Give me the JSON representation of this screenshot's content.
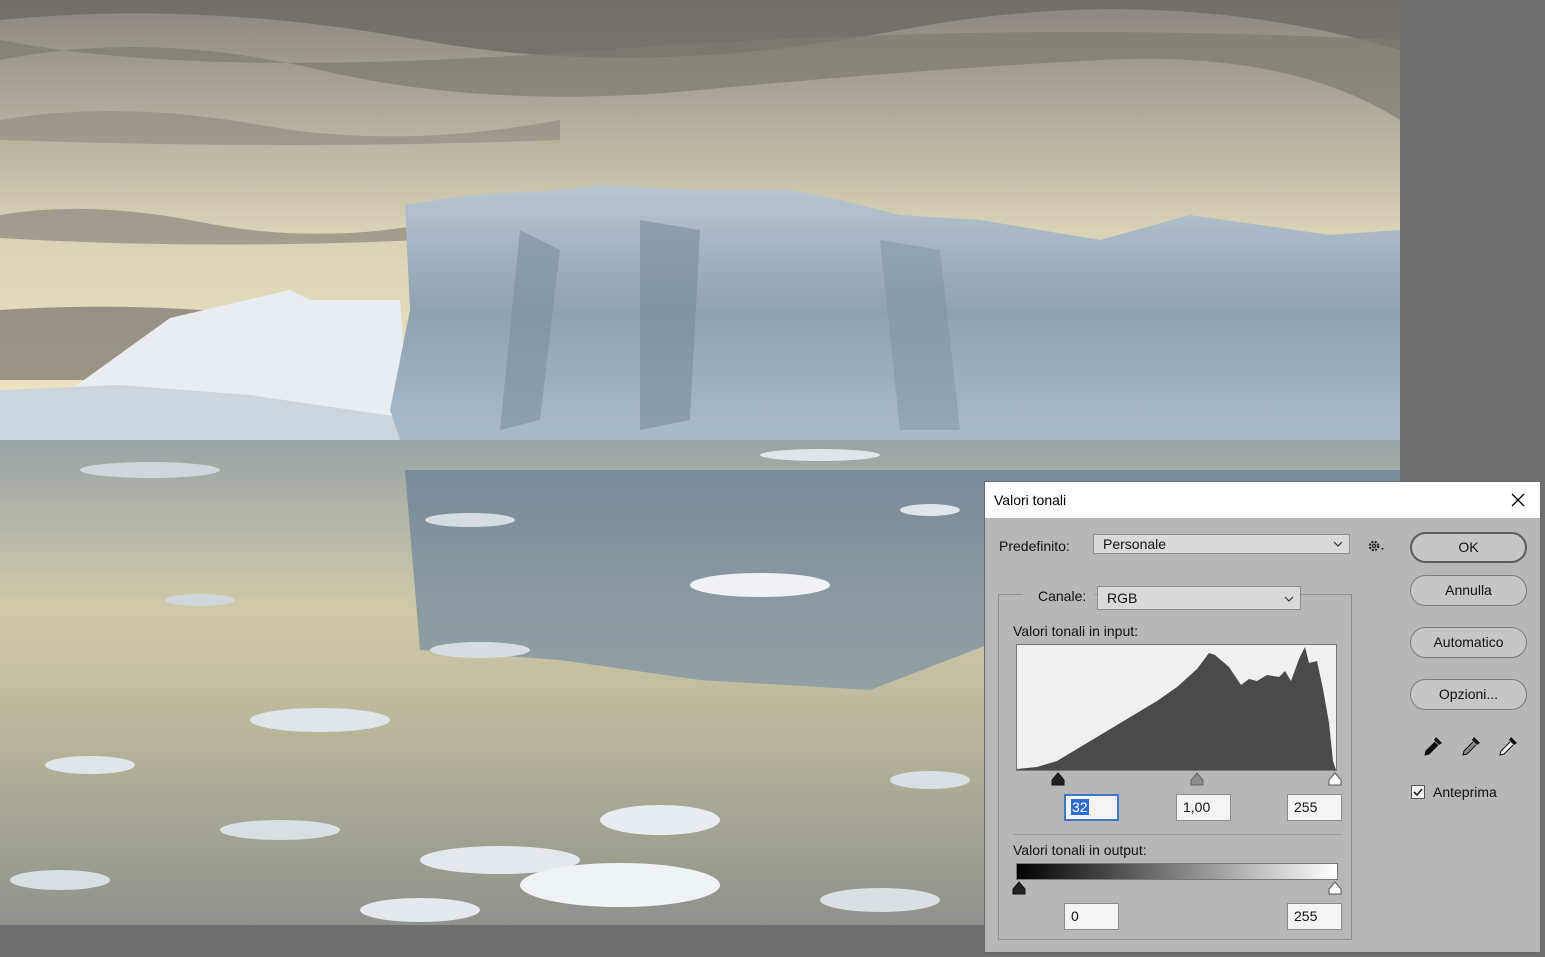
{
  "dialog": {
    "title": "Valori tonali",
    "preset": {
      "label": "Predefinito:",
      "value": "Personale"
    },
    "channel": {
      "label": "Canale:",
      "value": "RGB"
    },
    "input": {
      "label": "Valori tonali in input:",
      "black_value": "32",
      "gamma_value": "1,00",
      "white_value": "255"
    },
    "output": {
      "label": "Valori tonali in output:",
      "black_value": "0",
      "white_value": "255"
    },
    "buttons": {
      "ok": "OK",
      "cancel": "Annulla",
      "auto": "Automatico",
      "options": "Opzioni..."
    },
    "preview": {
      "label": "Anteprima",
      "checked": true
    },
    "icons": [
      "close-icon",
      "gear-icon",
      "chevron-down-icon",
      "eyedropper-black-icon",
      "eyedropper-gray-icon",
      "eyedropper-white-icon",
      "checkmark-icon"
    ]
  },
  "colors": {
    "dialog_bg": "#b7b7b7",
    "histogram_fill": "#4a4a4a",
    "selection": "#2d6bd1",
    "workspace_bg": "#6f6f6f"
  }
}
